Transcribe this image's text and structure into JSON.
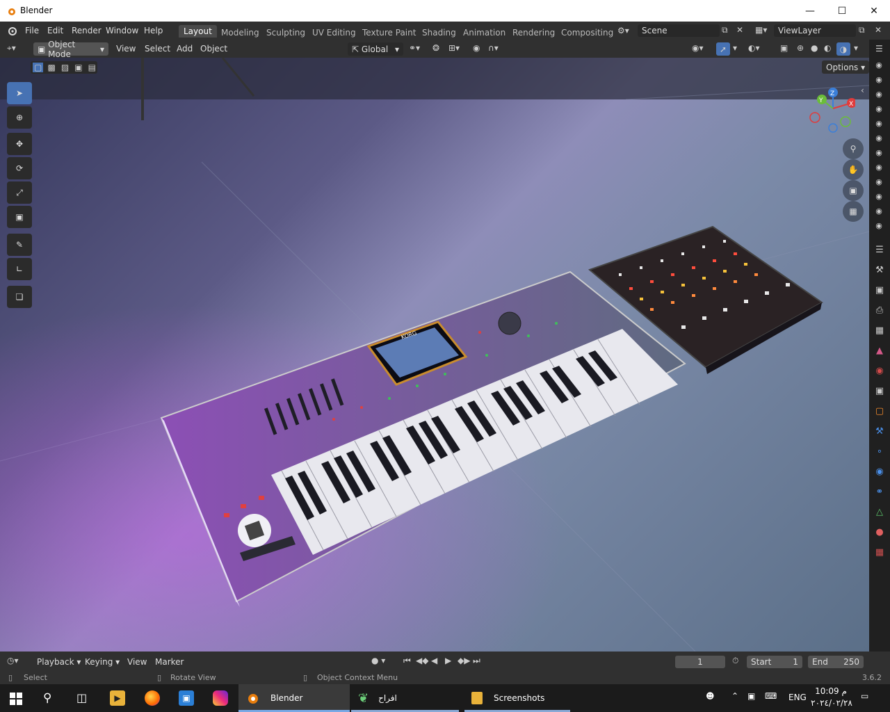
{
  "window": {
    "title": "Blender"
  },
  "menu": [
    "File",
    "Edit",
    "Render",
    "Window",
    "Help"
  ],
  "workspaces": [
    "Layout",
    "Modeling",
    "Sculpting",
    "UV Editing",
    "Texture Paint",
    "Shading",
    "Animation",
    "Rendering",
    "Compositing"
  ],
  "scene": {
    "name": "Scene"
  },
  "view_layer": {
    "name": "ViewLayer"
  },
  "header": {
    "mode": "Object Mode",
    "view_menu": [
      "View",
      "Select",
      "Add",
      "Object"
    ],
    "orientation": "Global",
    "options": "Options"
  },
  "gizmo": {
    "x": "X",
    "y": "Y",
    "z": "Z"
  },
  "instrument": {
    "brand": "KORG"
  },
  "timeline": {
    "menus": [
      "Playback",
      "Keying",
      "View",
      "Marker"
    ],
    "current_frame": "1",
    "start_label": "Start",
    "start": "1",
    "end_label": "End",
    "end": "250"
  },
  "status": {
    "select": "Select",
    "rotate": "Rotate View",
    "context": "Object Context Menu",
    "version": "3.6.2"
  },
  "taskbar": {
    "apps": [
      "Blender",
      "افراح",
      "Screenshots"
    ],
    "lang": "ENG",
    "time": "10:09 م",
    "date": "٢٠٢٤/٠٢/٢٨"
  },
  "colors": {
    "accent": "#4772b3",
    "header": "#303030",
    "x_axis": "#e03c3c",
    "y_axis": "#6bbd3a",
    "z_axis": "#3b7fd9"
  }
}
